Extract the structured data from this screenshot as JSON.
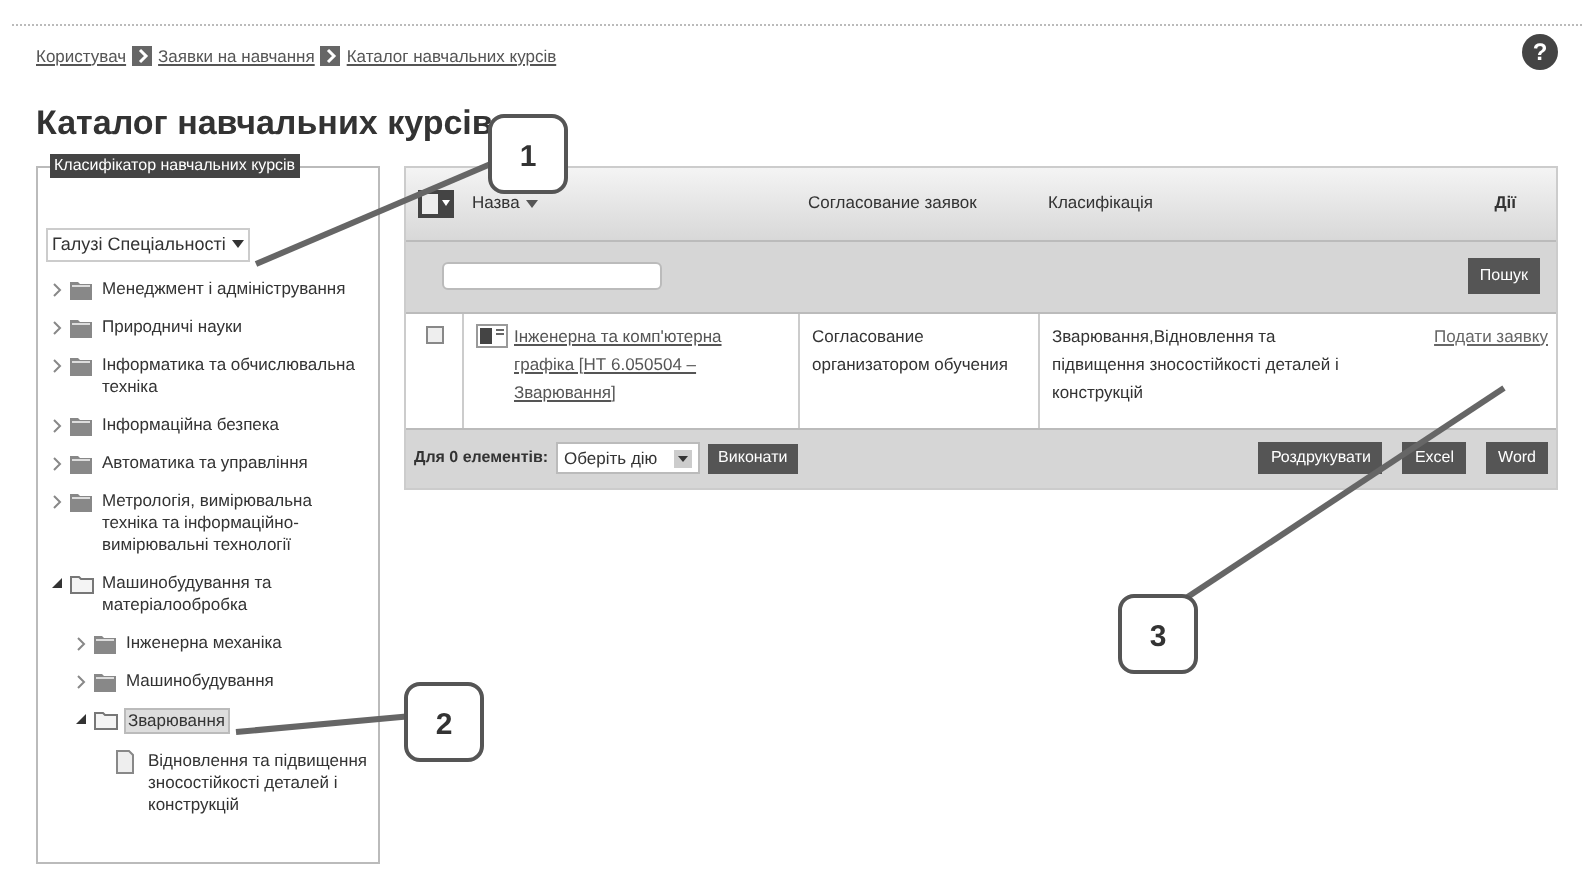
{
  "breadcrumb": [
    {
      "label": "Користувач"
    },
    {
      "label": "Заявки на навчання"
    },
    {
      "label": "Каталог навчальних курсів"
    }
  ],
  "help": "?",
  "title": "Каталог навчальних курсів",
  "classifier": {
    "legend": "Класифікатор навчальних курсів",
    "dropdown": "Галузі Спеціальності",
    "tree": [
      {
        "label": "Менеджмент і адміністрування",
        "expanded": false,
        "selected": false
      },
      {
        "label": "Природничі науки",
        "expanded": false,
        "selected": false
      },
      {
        "label": "Інформатика та обчислювальна техніка",
        "expanded": false,
        "selected": false
      },
      {
        "label": "Інформаційна безпека",
        "expanded": false,
        "selected": false
      },
      {
        "label": "Автоматика та управління",
        "expanded": false,
        "selected": false
      },
      {
        "label": "Метрологія, вимірювальна техніка та інформаційно-вимірювальні технології",
        "expanded": false,
        "selected": false
      },
      {
        "label": "Машинобудування та матеріалообробка",
        "expanded": true,
        "selected": false,
        "children": [
          {
            "label": "Інженерна механіка",
            "expanded": false,
            "selected": false
          },
          {
            "label": "Машинобудування",
            "expanded": false,
            "selected": false
          },
          {
            "label": "Зварювання",
            "expanded": true,
            "selected": true,
            "children": [
              {
                "label": "Відновлення та підвищення зносостійкості деталей і конструкцій",
                "kind": "leaf",
                "selected": false
              }
            ]
          }
        ]
      }
    ]
  },
  "table": {
    "select_all_checked": false,
    "columns": [
      {
        "label": "Назва",
        "sortable": true
      },
      {
        "label": "Согласование заявок",
        "sortable": false
      },
      {
        "label": "Класифікація",
        "sortable": false
      },
      {
        "label": "Дії",
        "sortable": false
      }
    ],
    "search_button": "Пошук",
    "rows": [
      {
        "checked": false,
        "name": "Інженерна та комп'ютерна графіка [НТ 6.050504 – Зварювання]",
        "approval": "Согласование организатором обучения",
        "classification": "Зварювання,Відновлення та підвищення зносостійкості деталей і конструкцій",
        "action": "Подати заявку"
      }
    ],
    "footer": {
      "label": "Для 0 елементів:",
      "select": "Оберіть дію",
      "execute": "Виконати",
      "exports": [
        "Роздрукувати",
        "Excel",
        "Word"
      ]
    }
  },
  "callouts": [
    {
      "label": "1"
    },
    {
      "label": "2"
    },
    {
      "label": "3"
    }
  ]
}
